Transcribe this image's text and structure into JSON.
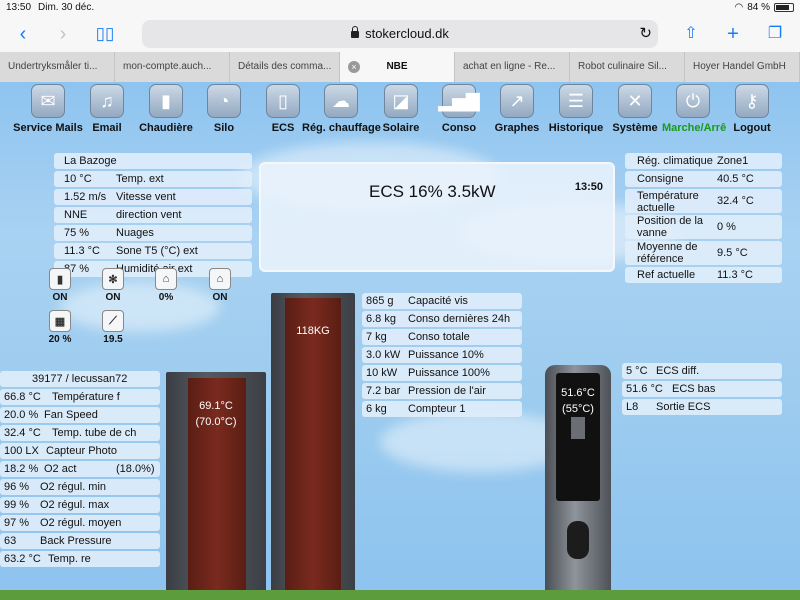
{
  "status_bar": {
    "time": "13:50",
    "date": "Dim. 30 déc.",
    "battery": "84 %",
    "battery_level": 0.84
  },
  "browser": {
    "url": "stokercloud.dk",
    "tabs": [
      {
        "label": "Undertryksmåler ti..."
      },
      {
        "label": "mon-compte.auch..."
      },
      {
        "label": "Détails des comma..."
      },
      {
        "label": "NBE",
        "active": true
      },
      {
        "label": "achat en ligne - Re..."
      },
      {
        "label": "Robot culinaire Sil..."
      },
      {
        "label": "Hoyer Handel GmbH"
      }
    ]
  },
  "nav": [
    {
      "label": "Service Mails",
      "icon": "mail-icon"
    },
    {
      "label": "Email",
      "icon": "bell-icon"
    },
    {
      "label": "Chaudière",
      "icon": "boiler-icon"
    },
    {
      "label": "Silo",
      "icon": "gauge-icon"
    },
    {
      "label": "ECS",
      "icon": "water-tank-icon"
    },
    {
      "label": "Rég. chauffage",
      "icon": "cloud-icon"
    },
    {
      "label": "Solaire",
      "icon": "solar-panel-icon"
    },
    {
      "label": "Conso",
      "icon": "bar-chart-icon"
    },
    {
      "label": "Graphes",
      "icon": "line-chart-icon"
    },
    {
      "label": "Historique",
      "icon": "list-icon"
    },
    {
      "label": "Système",
      "icon": "tools-icon"
    },
    {
      "label": "Marche/Arrê",
      "icon": "power-icon"
    },
    {
      "label": "Logout",
      "icon": "key-icon"
    }
  ],
  "weather": {
    "location": "La Bazoge",
    "rows": [
      {
        "value": "10 °C",
        "label": "Temp. ext"
      },
      {
        "value": "1.52 m/s",
        "label": "Vitesse vent"
      },
      {
        "value": "NNE",
        "label": "direction vent"
      },
      {
        "value": "75 %",
        "label": "Nuages"
      },
      {
        "value": "11.3 °C",
        "label": "Sone T5 (°C) ext"
      },
      {
        "value": "87 %",
        "label": "Humidité air ext"
      }
    ]
  },
  "mini_status": [
    {
      "value": "ON",
      "icon": "boiler-small-icon"
    },
    {
      "value": "ON",
      "icon": "fan-icon"
    },
    {
      "value": "0%",
      "icon": "house-heat-icon"
    },
    {
      "value": "ON",
      "icon": "house-icon"
    },
    {
      "value": "20 %",
      "icon": "solar-small-icon"
    },
    {
      "value": "19.5",
      "icon": "broom-icon"
    }
  ],
  "main_status": {
    "text": "ECS 16% 3.5kW",
    "time": "13:50"
  },
  "heating": {
    "rows": [
      {
        "label": "Rég. climatique",
        "value": "Zone1"
      },
      {
        "label": "Consigne",
        "value": "40.5 °C"
      },
      {
        "label": "Température actuelle",
        "value": "32.4 °C"
      },
      {
        "label": "Position de la vanne",
        "value": "0 %"
      },
      {
        "label": "Moyenne de référence",
        "value": "9.5 °C"
      },
      {
        "label": "Ref actuelle",
        "value": "11.3 °C"
      }
    ]
  },
  "consumption": {
    "rows": [
      {
        "value": "865 g",
        "label": "Capacité vis"
      },
      {
        "value": "6.8 kg",
        "label": "Conso dernières 24h"
      },
      {
        "value": "7 kg",
        "label": "Conso totale"
      },
      {
        "value": "3.0 kW",
        "label": "Puissance 10%"
      },
      {
        "value": "10 kW",
        "label": "Puissance 100%"
      },
      {
        "value": "7.2 bar",
        "label": "Pression de l'air"
      },
      {
        "value": "6 kg",
        "label": "Compteur 1"
      }
    ]
  },
  "boiler": {
    "header": "39177 / lecussan72",
    "rows": [
      {
        "value": "66.8 °C",
        "label": "Température f"
      },
      {
        "value": "20.0 %",
        "label": "Fan Speed"
      },
      {
        "value": "32.4 °C",
        "label": "Temp. tube de ch"
      },
      {
        "value": "100 LX",
        "label": "Capteur Photo"
      },
      {
        "value": "18.2 %",
        "label": "O2 act",
        "extra": "(18.0%)"
      },
      {
        "value": "96 %",
        "label": "O2 régul. min"
      },
      {
        "value": "99 %",
        "label": "O2 régul. max"
      },
      {
        "value": "97 %",
        "label": "O2 régul. moyen"
      },
      {
        "value": "63",
        "label": "Back Pressure"
      },
      {
        "value": "63.2 °C",
        "label": "Temp. re"
      }
    ],
    "temp": "69.1°C",
    "target": "(70.0°C)"
  },
  "silo": {
    "weight": "118KG"
  },
  "ecs": {
    "temp": "51.6°C",
    "target": "(55°C)",
    "rows": [
      {
        "value": "5 °C",
        "label": "ECS diff."
      },
      {
        "value": "51.6 °C",
        "label": "ECS bas"
      },
      {
        "value": "L8",
        "label": "Sortie ECS"
      }
    ]
  }
}
